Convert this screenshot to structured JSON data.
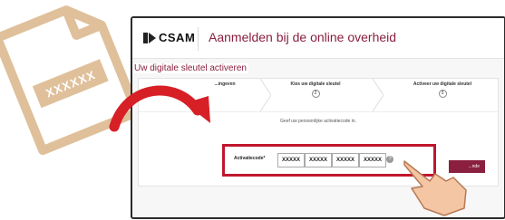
{
  "decor": {
    "doc_code": "XXXXXX"
  },
  "app": {
    "logo": "CSAM",
    "title": "Aanmelden bij de online overheid",
    "subtitle": "Uw digitale sleutel activeren"
  },
  "steps": [
    {
      "label": "...ingeven",
      "num": ""
    },
    {
      "label": "Kies uw digitale sleutel",
      "num": "2"
    },
    {
      "label": "Activeer uw digitale sleutel",
      "num": "3"
    }
  ],
  "hint": "Geef uw persoonlijke activatiecode in.",
  "activation": {
    "label": "Activatiecode*",
    "fields": [
      "XXXXX",
      "XXXXX",
      "XXXXX",
      "XXXXX"
    ],
    "help": "?"
  },
  "buttons": {
    "next": "...nde"
  },
  "colors": {
    "accent": "#8a1f3f",
    "highlight": "#c0162d",
    "doc": "#dfc09a"
  }
}
